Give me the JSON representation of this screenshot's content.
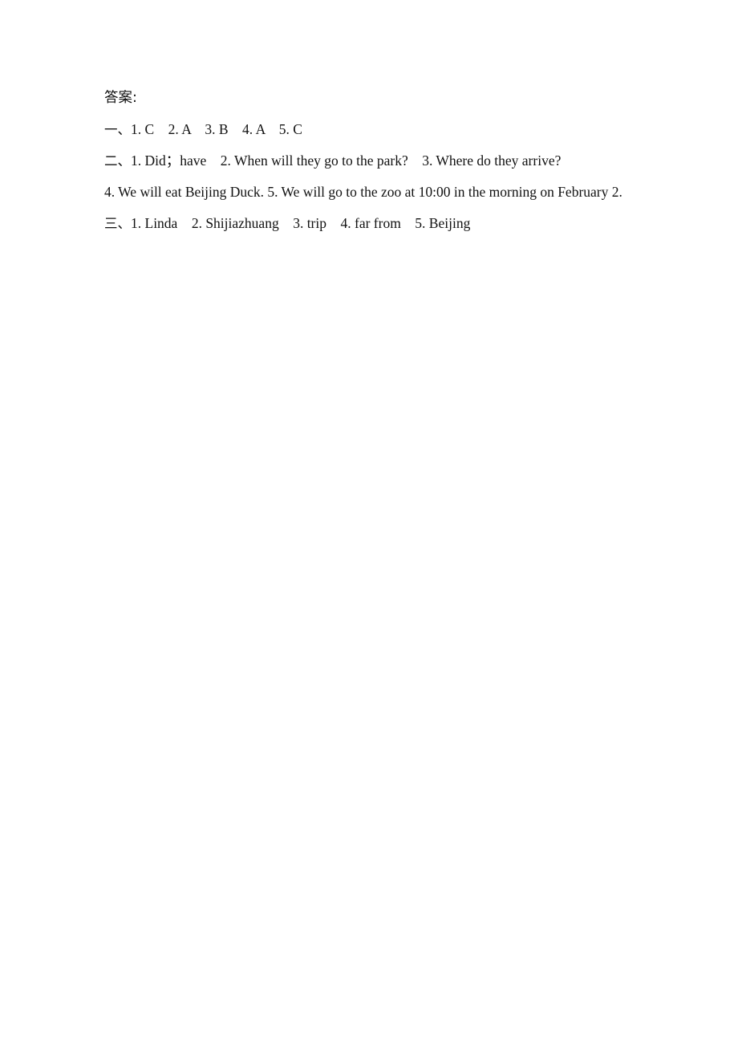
{
  "document": {
    "heading": "答案:",
    "sections": [
      {
        "marker": "一、",
        "items_inline": "1. C    2. A    3. B    4. A    5. C",
        "items": [
          {
            "number": "1.",
            "answer": "C"
          },
          {
            "number": "2.",
            "answer": "A"
          },
          {
            "number": "3.",
            "answer": "B"
          },
          {
            "number": "4.",
            "answer": "A"
          },
          {
            "number": "5.",
            "answer": "C"
          }
        ]
      },
      {
        "marker": "二、",
        "line_one": "1. Did；have    2. When will they go to the park?    3. Where do they arrive?",
        "line_two": "4. We will eat Beijing Duck.    5. We will go to the zoo at 10:00 in the morning on February 2.",
        "items": [
          {
            "number": "1.",
            "answer": "Did；have"
          },
          {
            "number": "2.",
            "answer": "When will they go to the park?"
          },
          {
            "number": "3.",
            "answer": "Where do they arrive?"
          },
          {
            "number": "4.",
            "answer": "We will eat Beijing Duck."
          },
          {
            "number": "5.",
            "answer": "We will go to the zoo at 10:00 in the morning on February 2."
          }
        ]
      },
      {
        "marker": "三、",
        "items_inline": "1. Linda    2. Shijiazhuang    3. trip    4. far from    5. Beijing",
        "items": [
          {
            "number": "1.",
            "answer": "Linda"
          },
          {
            "number": "2.",
            "answer": "Shijiazhuang"
          },
          {
            "number": "3.",
            "answer": "trip"
          },
          {
            "number": "4.",
            "answer": "far from"
          },
          {
            "number": "5.",
            "answer": "Beijing"
          }
        ]
      }
    ]
  },
  "colors": {
    "page_background": "#ffffff",
    "text": "#111111"
  }
}
